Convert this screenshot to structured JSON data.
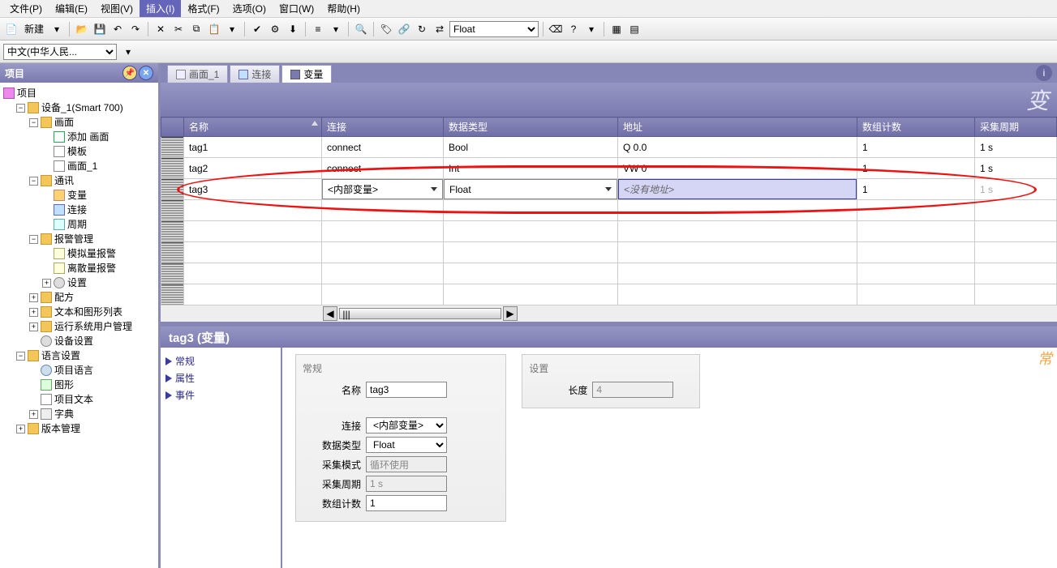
{
  "menu": {
    "file": "文件(P)",
    "edit": "编辑(E)",
    "view": "视图(V)",
    "insert": "插入(I)",
    "format": "格式(F)",
    "options": "选项(O)",
    "window": "窗口(W)",
    "help": "帮助(H)"
  },
  "toolbar": {
    "new_label": "新建",
    "type_select": "Float",
    "lang_select": "中文(中华人民..."
  },
  "project_panel": {
    "title": "项目",
    "root": "项目",
    "device": "设备_1(Smart 700)",
    "screens": "画面",
    "add_screen": "添加 画面",
    "template": "模板",
    "screen_1": "画面_1",
    "comm": "通讯",
    "variables": "变量",
    "connection": "连接",
    "cycle": "周期",
    "alarms": "报警管理",
    "analog_alarm": "模拟量报警",
    "discrete_alarm": "离散量报警",
    "alarm_settings": "设置",
    "recipes": "配方",
    "text_graphics": "文本和图形列表",
    "runtime_users": "运行系统用户管理",
    "device_settings": "设备设置",
    "language": "语言设置",
    "project_lang": "项目语言",
    "graphics": "图形",
    "project_texts": "项目文本",
    "dictionary": "字典",
    "versioning": "版本管理"
  },
  "editor_tabs": {
    "screen": "画面_1",
    "conn": "连接",
    "vars": "变量"
  },
  "editor_title_hint": "变",
  "table": {
    "cols": {
      "name": "名称",
      "conn": "连接",
      "type": "数据类型",
      "addr": "地址",
      "arrcount": "数组计数",
      "cycle": "采集周期"
    },
    "rows": [
      {
        "name": "tag1",
        "conn": "connect",
        "type": "Bool",
        "addr": "Q 0.0",
        "arrcount": "1",
        "cycle": "1 s"
      },
      {
        "name": "tag2",
        "conn": "connect",
        "type": "Int",
        "addr": "VW 0",
        "arrcount": "1",
        "cycle": "1 s"
      },
      {
        "name": "tag3",
        "conn": "<内部变量>",
        "type": "Float",
        "addr": "<没有地址>",
        "arrcount": "1",
        "cycle": "1 s"
      }
    ]
  },
  "props": {
    "title": "tag3 (变量)",
    "nav": {
      "general": "常规",
      "attrs": "属性",
      "events": "事件"
    },
    "corner_hint": "常",
    "general_group": "常规",
    "settings_group": "设置",
    "fields": {
      "name_lbl": "名称",
      "name_val": "tag3",
      "conn_lbl": "连接",
      "conn_val": "<内部变量>",
      "type_lbl": "数据类型",
      "type_val": "Float",
      "mode_lbl": "采集模式",
      "mode_val": "循环使用",
      "cycle_lbl": "采集周期",
      "cycle_val": "1 s",
      "arr_lbl": "数组计数",
      "arr_val": "1",
      "len_lbl": "长度",
      "len_val": "4"
    }
  }
}
